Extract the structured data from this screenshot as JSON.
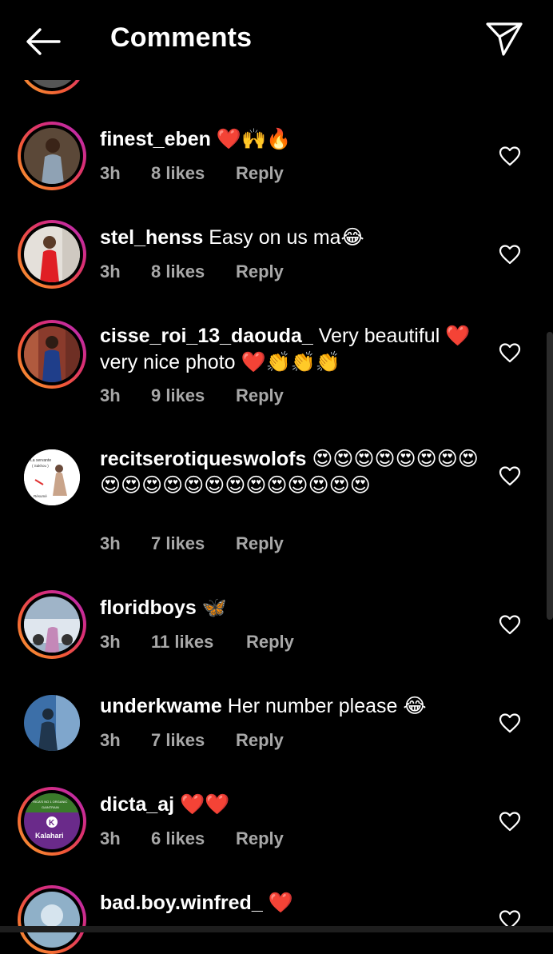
{
  "header": {
    "title": "Comments"
  },
  "comments": [
    {
      "username": "finest_eben",
      "text": " ❤️🙌🔥",
      "time": "3h",
      "likes": "8 likes",
      "reply": "Reply"
    },
    {
      "username": "stel_henss",
      "text": " Easy on us ma😂",
      "time": "3h",
      "likes": "8 likes",
      "reply": "Reply"
    },
    {
      "username": "cisse_roi_13_daouda_",
      "text": " Very beautiful ❤️ very nice photo ❤️👏👏👏",
      "time": "3h",
      "likes": "9 likes",
      "reply": "Reply"
    },
    {
      "username": "recitserotiqueswolofs",
      "text": " 😍😍😍😍😍😍😍😍😍😍😍😍😍😍😍😍😍😍😍😍😍",
      "time": "3h",
      "likes": "7 likes",
      "reply": "Reply",
      "avatar_text": [
        "La servante",
        "( Sakhou )",
        "Résumé"
      ]
    },
    {
      "username": "floridboys",
      "text": " 🦋",
      "time": "3h",
      "likes": "11 likes",
      "reply": "Reply"
    },
    {
      "username": "underkwame",
      "text": " Her number please 😂",
      "time": "3h",
      "likes": "7 likes",
      "reply": "Reply"
    },
    {
      "username": "dicta_aj",
      "text": " ❤️❤️",
      "time": "3h",
      "likes": "6 likes",
      "reply": "Reply",
      "avatar_text": [
        "AFRICA'S NO 1 ORGANIC",
        "GAINTRAIN",
        "K",
        "Kalahari"
      ]
    },
    {
      "username": "bad.boy.winfred_",
      "text": " ❤️"
    }
  ],
  "colors": {
    "background": "#000000",
    "text": "#ffffff",
    "meta": "#a8a8a8",
    "ring_start": "#f7a533",
    "ring_end": "#b22ac1"
  },
  "icons": [
    "back-arrow-icon",
    "send-icon",
    "heart-outline-icon"
  ]
}
